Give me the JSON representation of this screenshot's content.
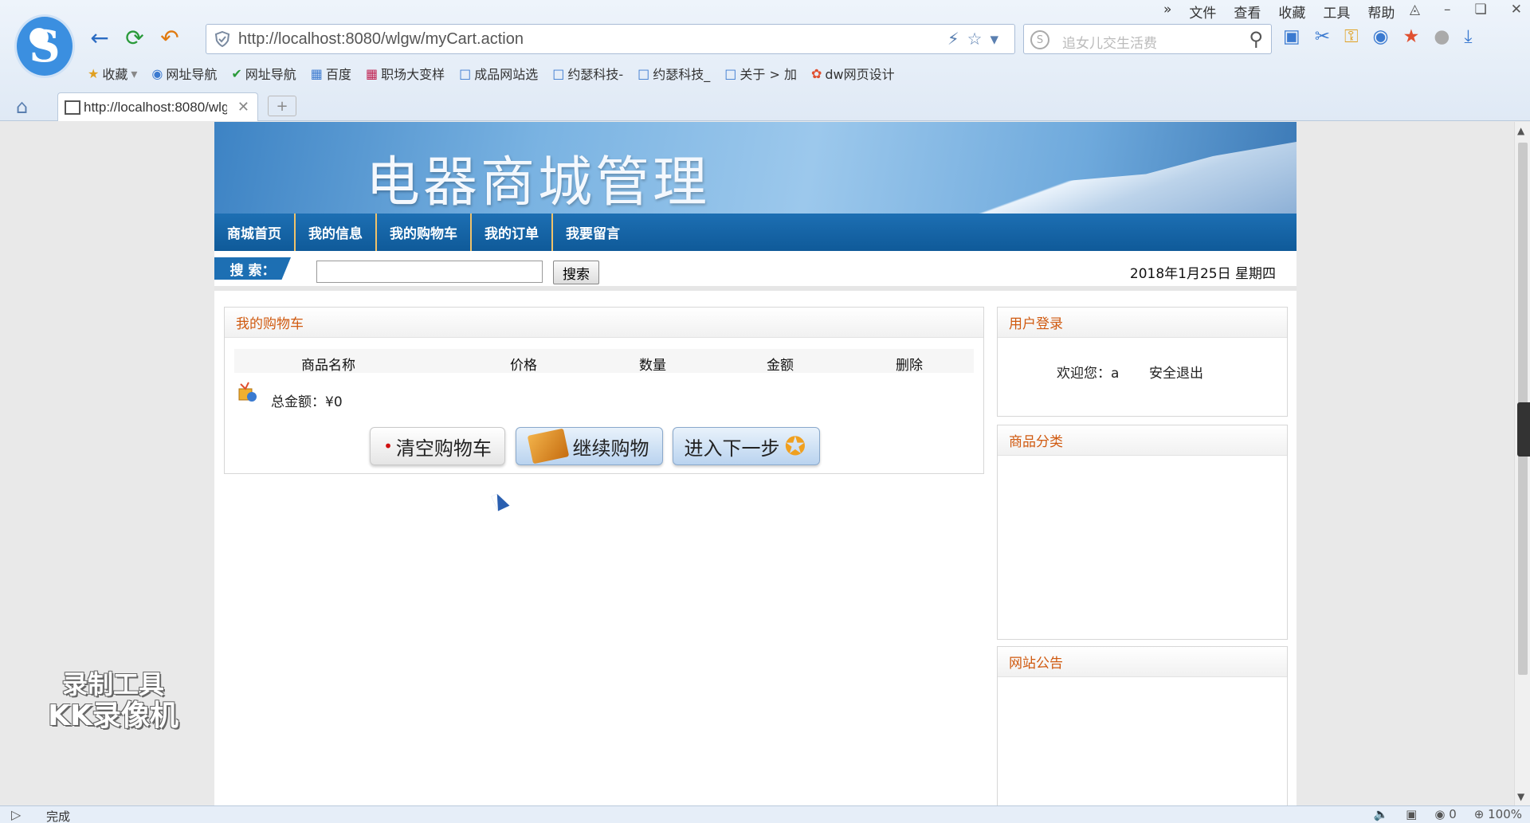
{
  "browser": {
    "url": "http://localhost:8080/wlgw/myCart.action",
    "search_placeholder": "追女儿交生活费",
    "menu": [
      "文件",
      "查看",
      "收藏",
      "工具",
      "帮助"
    ],
    "bookmarks": [
      "收藏",
      "网址导航",
      "网址导航",
      "百度",
      "职场大变样",
      "成品网站选",
      "约瑟科技-",
      "约瑟科技_",
      "关于 > 加",
      "dw网页设计"
    ],
    "tab_title": "http://localhost:8080/wlgw/myCart.action",
    "status": "完成",
    "status_right": {
      "count": "0",
      "zoom": "100%"
    }
  },
  "site": {
    "banner_title": "电器商城管理",
    "nav": [
      "商城首页",
      "我的信息",
      "我的购物车",
      "我的订单",
      "我要留言"
    ],
    "search_label": "搜 索：",
    "search_button": "搜索",
    "date": "2018年1月25日 星期四"
  },
  "cart": {
    "heading": "我的购物车",
    "columns": [
      "商品名称",
      "价格",
      "数量",
      "金额",
      "删除"
    ],
    "total": "总金额：¥0",
    "buttons": {
      "clear": "清空购物车",
      "continue": "继续购物",
      "next": "进入下一步"
    }
  },
  "sidebar": {
    "login_heading": "用户登录",
    "welcome": "欢迎您：a",
    "logout": "安全退出",
    "categories_heading": "商品分类",
    "notice_heading": "网站公告"
  },
  "watermark": {
    "line1": "录制工具",
    "line2": "KK录像机"
  },
  "colors": {
    "nav_blue": "#1d6fb3",
    "panel_heading": "#d05a10"
  }
}
